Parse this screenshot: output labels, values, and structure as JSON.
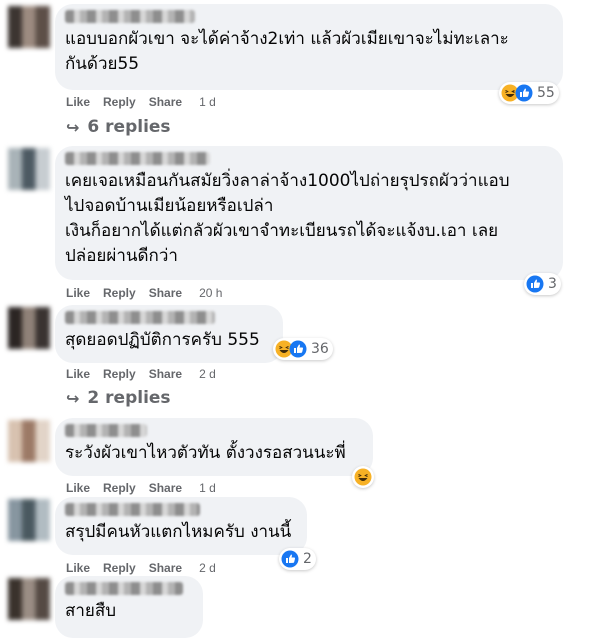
{
  "actions": {
    "like": "Like",
    "reply": "Reply",
    "share": "Share"
  },
  "comments": [
    {
      "text": "แอบบอกผัวเขา จะได้ค่าจ้าง2เท่า แล้วผัวเมียเขาจะไม่ทะเลาะ\nกันด้วย55",
      "time": "1 d",
      "reaction_count": "55",
      "reactions": [
        "haha-icon",
        "like-icon"
      ],
      "replies": "6 replies"
    },
    {
      "text": "เคยเจอเหมือนกันสมัยวิ่งลาล่าจ้าง1000ไปถ่ายรุปรถผัวว่าแอบ\nไปจอดบ้านเมียน้อยหรือเปล่า\nเงินก็อยากได้แต่กลัวผัวเขาจำทะเบียนรถได้จะแจ้งบ.เอา เลย\nปล่อยผ่านดีกว่า",
      "time": "20 h",
      "reaction_count": "3",
      "reactions": [
        "like-icon"
      ]
    },
    {
      "text": "สุดยอดปฏิบัติการครับ 555",
      "time": "2 d",
      "reaction_count": "36",
      "reactions": [
        "haha-icon",
        "like-icon"
      ],
      "replies": "2 replies"
    },
    {
      "text": "ระวังผัวเขาไหวตัวทัน ตั้งวงรอสวนนะพี่",
      "time": "1 d",
      "reaction_count": "",
      "reactions": [
        "haha-icon"
      ]
    },
    {
      "text": "สรุปมีคนหัวแตกไหมครับ งานนี้",
      "time": "2 d",
      "reaction_count": "2",
      "reactions": [
        "like-icon"
      ]
    },
    {
      "text": "สายสืบ"
    }
  ],
  "colors": {
    "bubble": "#f0f2f5",
    "like_blue": "#1877f2",
    "haha_yellow": "#f7b125",
    "meta_gray": "#65676b"
  }
}
